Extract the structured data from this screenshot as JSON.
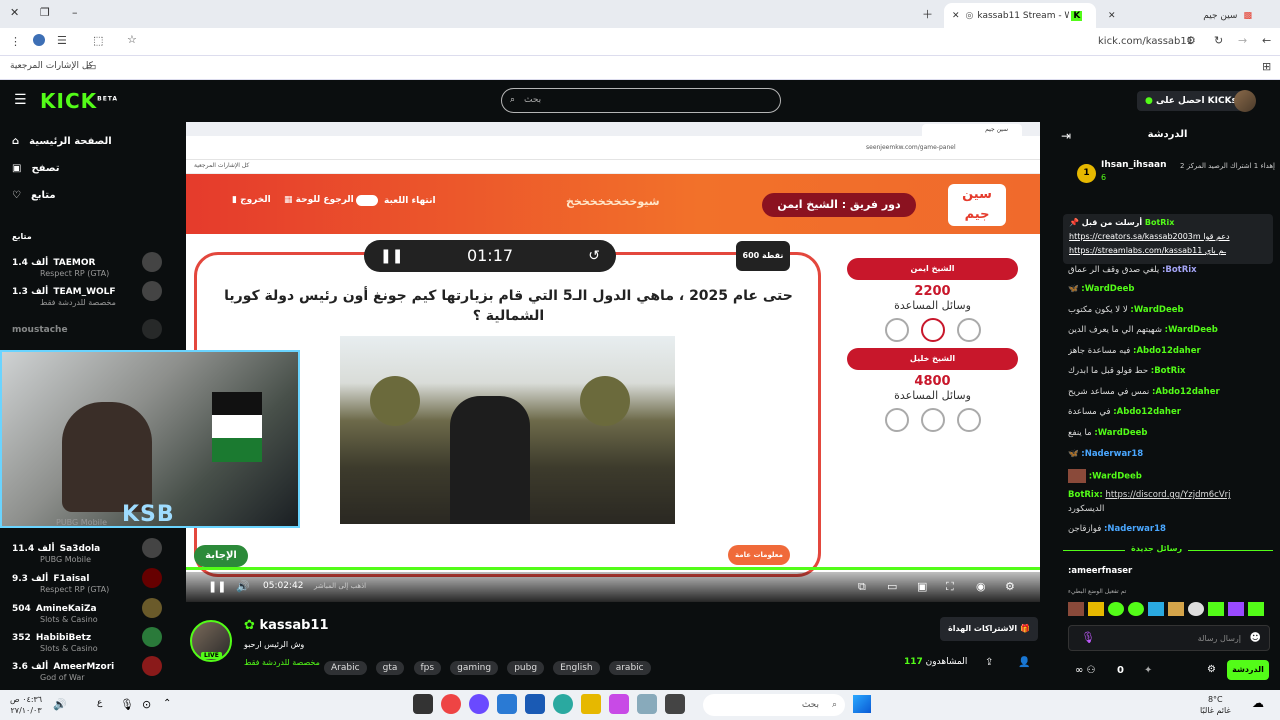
{
  "browser": {
    "tabs": [
      {
        "label": "kassab11 Stream - Watch Li",
        "active": true
      },
      {
        "label": "سين جيم",
        "active": false
      }
    ],
    "url": "kick.com/kassab11",
    "bookmarks_label": "كل الإشارات المرجعية"
  },
  "kick": {
    "logo": "KICK",
    "logo_badge": "BETA",
    "search_placeholder": "بحث",
    "get_kicks": "احصل على KICKs",
    "nav": {
      "home": "الصفحة الرئيسية",
      "browse": "تصفح",
      "following": "متابع",
      "following_header": "متابع"
    },
    "channels": [
      {
        "name": "TAEMOR",
        "viewers": "1.4 ألف",
        "category": "Respect RP (GTA)"
      },
      {
        "name": "TEAM_WOLF",
        "viewers": "1.3 ألف",
        "category": "مخصصة للدردشة فقط"
      },
      {
        "name": "moustache",
        "viewers": "",
        "category": ""
      },
      {
        "name": "Sa3dola",
        "viewers": "11.4 ألف",
        "category": "PUBG Mobile"
      },
      {
        "name": "F1aisal",
        "viewers": "9.3 ألف",
        "category": "Respect RP (GTA)"
      },
      {
        "name": "AmineKaiZa",
        "viewers": "504",
        "category": "Slots & Casino"
      },
      {
        "name": "HabibiBetz",
        "viewers": "352",
        "category": "Slots & Casino"
      },
      {
        "name": "AmeerMzori",
        "viewers": "3.6 ألف",
        "category": "God of War"
      }
    ],
    "webcam_overlay_text": "PUBG Mobile",
    "webcam_overlay_logo": "KSB"
  },
  "player": {
    "inner_url": "seenjeemkw.com/game-panel",
    "inner_tab": "سين جيم",
    "inner_bookmarks": "كل الإشارات المرجعية",
    "header": {
      "logo": "سين جيم",
      "turn": "دور فريق : الشيخ ايمن",
      "center_text": "شيوخخخخخخخخخ",
      "end_game": "انتهاء اللعبة",
      "back_to_board": "الرجوع للوحة",
      "exit": "الخروج"
    },
    "points": "600 نقطة",
    "timer": "01:17",
    "question": "حتى عام 2025 ، ماهي الدول الـ5 التي قام بزيارتها كيم جونغ أون رئيس دولة كوريا الشمالية ؟",
    "answer_button": "الإجابة",
    "general_info_button": "معلومات عامة",
    "teams": [
      {
        "name": "الشيخ ايمن",
        "score": "2200",
        "help_label": "وسائل المساعدة"
      },
      {
        "name": "الشيخ خليل",
        "score": "4800",
        "help_label": "وسائل المساعدة"
      }
    ],
    "controls": {
      "time": "05:02:42",
      "live_label": "اذهب إلى المباشر"
    },
    "progress_fraction": 1.0
  },
  "stream": {
    "streamer": "kassab11",
    "title": "وش الرئيس ارحبو",
    "live_badge": "LIVE",
    "category": "مخصصة للدردشة فقط",
    "tags": [
      "Arabic",
      "gta",
      "fps",
      "gaming",
      "pubg",
      "English",
      "arabic"
    ],
    "subs_button": "الاشتراكات الهداة",
    "viewers_label": "المشاهدون",
    "viewers": "117"
  },
  "chat": {
    "title": "الدردشة",
    "gifter": {
      "user": "Ihsan_ihsaan",
      "count": "6",
      "text": "إهداء 1 اشتراك الرصيد المركز 2"
    },
    "pinned": {
      "by": "أرسلت من قبل",
      "user": "BotRix",
      "line1": "https://creators.sa/kassab2003m دعم قوا",
      "line2": "https://streamlabs.com/kassab11 ـم باي"
    },
    "messages": [
      {
        "user": "BotRix:",
        "text": "يلغي صدق وقف الر عماق",
        "color": "#a4a4f4"
      },
      {
        "user": "WardDeeb:",
        "text": "🦋",
        "color": "#53fc18"
      },
      {
        "user": "WardDeeb:",
        "text": "لا لا يكون مكتوب",
        "color": "#53fc18"
      },
      {
        "user": "WardDeeb:",
        "text": "شهيتهم الي ما يعرف الدين",
        "color": "#53fc18"
      },
      {
        "user": "Abdo12daher:",
        "text": "فيه مساعدة جاهز",
        "color": "#53fc18"
      },
      {
        "user": "BotRix:",
        "text": "حط فولو قبل ما ابدرك",
        "color": "#53fc18"
      },
      {
        "user": "Abdo12daher:",
        "text": "نمس في مساعد شريح",
        "color": "#53fc18"
      },
      {
        "user": "Abdo12daher:",
        "text": "في مساعدة",
        "color": "#53fc18"
      },
      {
        "user": "WardDeeb:",
        "text": "ما ينفع",
        "color": "#53fc18"
      },
      {
        "user": "Naderwar18:",
        "text": "🦋",
        "color": "#4aa7ff"
      },
      {
        "user": "WardDeeb:",
        "text": "",
        "color": "#53fc18"
      },
      {
        "user": "BotRix:",
        "text": "https://discord.gg/Yzjdm6cVrj",
        "color": "#53fc18"
      },
      {
        "user": "",
        "text": "الديسكورد",
        "color": "#ddd"
      },
      {
        "user": "Naderwar18:",
        "text": "فوازقاجن",
        "color": "#4aa7ff"
      }
    ],
    "new_messages": "رسائل جديدة",
    "last_msg": {
      "user": "ameerfnaser:",
      "text": ""
    },
    "welcome": "تم تفعيل الوضع البطيء",
    "input_placeholder": "إرسال رسالة",
    "send_button": "الدردشة",
    "points": "0"
  },
  "taskbar": {
    "search_placeholder": "بحث",
    "time": "٠٤:٣٦ ص",
    "date": "٢٧/١٠/٠٣",
    "weather_temp": "8°C",
    "weather_text": "غائم غالبًا"
  },
  "colors": {
    "kick_green": "#53fc18",
    "game_red": "#c8172b",
    "game_orange": "#f2712a",
    "background": "#0b0e0f"
  }
}
